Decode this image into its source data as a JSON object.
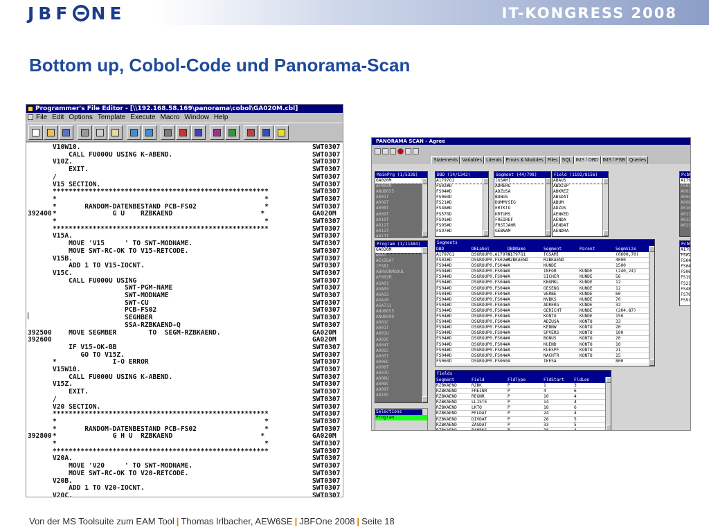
{
  "header": {
    "logo": "JBFONE",
    "logo_prefix": "JBF",
    "logo_suffix": "NE",
    "event": "IT-KONGRESS 2008"
  },
  "title": "Bottom up, Cobol-Code und Panorama-Scan",
  "footer": {
    "part1": "Von der MS Toolsuite zum EAM Tool",
    "part2": "Thomas Irlbacher, AEW6SE",
    "part3": "JBFOne 2008",
    "part4": "Seite 18",
    "separator": "|"
  },
  "editor": {
    "title": "Programmer's File Editor - [\\\\192.168.58.169\\panorama\\cobol\\GA020M.cbl]",
    "menu": [
      "File",
      "Edit",
      "Options",
      "Template",
      "Execute",
      "Macro",
      "Window",
      "Help"
    ],
    "toolbar_icons": [
      "new-file-icon",
      "open-folder-icon",
      "save-icon",
      "cut-icon",
      "copy-icon",
      "paste-icon",
      "find-icon",
      "find-next-icon",
      "print-icon",
      "execute-icon",
      "macro-icon",
      "options-icon",
      "settings-icon",
      "wrap-icon",
      "abc-case-icon",
      "help-icon"
    ],
    "lines": [
      {
        "seq": "",
        "code": "V10W10.",
        "id": "SWT0307"
      },
      {
        "seq": "",
        "code": "    CALL FU000U USING K-ABEND.",
        "id": "SWT0307"
      },
      {
        "seq": "",
        "code": "V10Z.",
        "id": "SWT0307"
      },
      {
        "seq": "",
        "code": "    EXIT.",
        "id": "SWT0307"
      },
      {
        "seq": "",
        "code": "/",
        "id": "SWT0307"
      },
      {
        "seq": "",
        "code": "V15 SECTION.",
        "id": "SWT0307"
      },
      {
        "seq": "",
        "code": "******************************************************",
        "id": "SWT0307"
      },
      {
        "seq": "",
        "code": "*                                                    *",
        "id": "SWT0307"
      },
      {
        "seq": "",
        "code": "*       RANDOM-DATENBESTAND PCB-FS02                 *",
        "id": "SWT0307"
      },
      {
        "seq": "392400",
        "code": "*              G U    RZBKAEND                      *",
        "id": "GA020M"
      },
      {
        "seq": "",
        "code": "*                                                    *",
        "id": "SWT0307"
      },
      {
        "seq": "",
        "code": "******************************************************",
        "id": "SWT0307"
      },
      {
        "seq": "",
        "code": "V15A.",
        "id": "SWT0307"
      },
      {
        "seq": "",
        "code": "    MOVE 'V15     ' TO SWT-MODNAME.",
        "id": "SWT0307"
      },
      {
        "seq": "",
        "code": "    MOVE SWT-RC-OK TO V15-RETCODE.",
        "id": "SWT0307"
      },
      {
        "seq": "",
        "code": "V15B.",
        "id": "SWT0307"
      },
      {
        "seq": "",
        "code": "    ADD 1 TO V15-IOCNT.",
        "id": "SWT0307"
      },
      {
        "seq": "",
        "code": "V15C.",
        "id": "SWT0307"
      },
      {
        "seq": "",
        "code": "    CALL FU000U USING",
        "id": "SWT0307"
      },
      {
        "seq": "",
        "code": "                  SWT-PGM-NAME",
        "id": "SWT0307"
      },
      {
        "seq": "",
        "code": "                  SWT-MODNAME",
        "id": "SWT0307"
      },
      {
        "seq": "",
        "code": "                  SWT-CU",
        "id": "SWT0307"
      },
      {
        "seq": "",
        "code": "                  PCB-FS02",
        "id": "SWT0307"
      },
      {
        "seq": "",
        "code": "                  SEGHBER",
        "id": "SWT0307"
      },
      {
        "seq": "",
        "code": "                  SSA-RZBKAEND-Q",
        "id": "SWT0307"
      },
      {
        "seq": "392500",
        "code": "    MOVE SEGMBER        TO  SEGM-RZBKAEND.",
        "id": "GA020M"
      },
      {
        "seq": "392600",
        "code": "",
        "id": "GA020M"
      },
      {
        "seq": "",
        "code": "    IF V15-OK-BB",
        "id": "SWT0307"
      },
      {
        "seq": "",
        "code": "       GO TO V15Z.",
        "id": "SWT0307"
      },
      {
        "seq": "",
        "code": "*              I-O ERROR",
        "id": "SWT0307"
      },
      {
        "seq": "",
        "code": "V15W10.",
        "id": "SWT0307"
      },
      {
        "seq": "",
        "code": "    CALL FU000U USING K-ABEND.",
        "id": "SWT0307"
      },
      {
        "seq": "",
        "code": "V15Z.",
        "id": "SWT0307"
      },
      {
        "seq": "",
        "code": "    EXIT.",
        "id": "SWT0307"
      },
      {
        "seq": "",
        "code": "/",
        "id": "SWT0307"
      },
      {
        "seq": "",
        "code": "V20 SECTION.",
        "id": "SWT0307"
      },
      {
        "seq": "",
        "code": "******************************************************",
        "id": "SWT0307"
      },
      {
        "seq": "",
        "code": "*                                                    *",
        "id": "SWT0307"
      },
      {
        "seq": "",
        "code": "*       RANDOM-DATENBESTAND PCB-FS02                 *",
        "id": "SWT0307"
      },
      {
        "seq": "392800",
        "code": "*              G H U  RZBKAEND                      *",
        "id": "GA020M"
      },
      {
        "seq": "",
        "code": "*                                                    *",
        "id": "SWT0307"
      },
      {
        "seq": "",
        "code": "******************************************************",
        "id": "SWT0307"
      },
      {
        "seq": "",
        "code": "V20A.",
        "id": "SWT0307"
      },
      {
        "seq": "",
        "code": "    MOVE 'V20     ' TO SWT-MODNAME.",
        "id": "SWT0307"
      },
      {
        "seq": "",
        "code": "    MOVE SWT-RC-OK TO V20-RETCODE.",
        "id": "SWT0307"
      },
      {
        "seq": "",
        "code": "V20B.",
        "id": "SWT0307"
      },
      {
        "seq": "",
        "code": "    ADD 1 TO V20-IOCNT.",
        "id": "SWT0307"
      },
      {
        "seq": "",
        "code": "V20C.",
        "id": "SWT0307"
      }
    ]
  },
  "panorama": {
    "title": "PANORAMA SCAN - Agree",
    "tabs": [
      "Statements",
      "Variables",
      "Literals",
      "Errors & Modules",
      "Files",
      "SQL",
      "IMS / DBD",
      "IMS / PSB",
      "Queries"
    ],
    "active_tab": "IMS / DBD",
    "mainprg": {
      "header": "MainPrg (1/5338)",
      "items": [
        "GA020M",
        "AF002M",
        "ANUB055",
        "A001T",
        "A006T",
        "A008T",
        "A009T",
        "A010T",
        "A011T",
        "A012T",
        "A013T"
      ]
    },
    "program": {
      "header": "Program (1/11484)",
      "items": [
        "GA020M",
        "#DAT",
        "#EXIDAT",
        "[PSB]",
        "ABRVORMODUL",
        "AF002M",
        "AGA01",
        "AGA05",
        "AGA15",
        "AGA20",
        "AGA731",
        "ANUB055",
        "ANUB099",
        "A001C",
        "A001T",
        "A001U",
        "A003C",
        "A004T",
        "A005C",
        "A005T",
        "A006C",
        "A006T",
        "A007U",
        "A008U",
        "A009C",
        "A009T",
        "A010C"
      ]
    },
    "selections": {
      "header": "Selections",
      "items": [
        "Program"
      ]
    },
    "dbd": {
      "header": "DBD (14/1342)",
      "items": [
        "A1797G1",
        "FS02#D",
        "FS04#D",
        "FS060D",
        "FS21#D",
        "FS48#D",
        "FS570D",
        "FS91#D",
        "FS95#D",
        "FS97#D"
      ]
    },
    "segment": {
      "header": "Segment (44/798)",
      "items": [
        "[GSAM]",
        "ADRERG",
        "ADZUSA",
        "BONUS",
        "DUMMYSEG",
        "ERTKTO",
        "KRTUMS",
        "FREIREF",
        "FRSTJAHR",
        "GEBNAM"
      ]
    },
    "field": {
      "header": "Field (1192/8156)",
      "items": [
        "ABAUS",
        "ABDISP",
        "ABKREZ",
        "ABSDAT",
        "ABUM",
        "ADZUS",
        "AENKED",
        "AENDA",
        "AENDAT",
        "AENDRA"
      ]
    },
    "pcb": {
      "header": "PcbNr",
      "items": [
        "A179",
        "FS02",
        "A001",
        "A003",
        "A008",
        "A010",
        "A011",
        "A012",
        "A013"
      ]
    },
    "pcb2": {
      "header": "PcbN",
      "items": [
        "A179",
        "FS02",
        "FS04",
        "FS04",
        "FS06",
        "FS19",
        "FS21",
        "FS48",
        "FS70",
        "FS91"
      ]
    },
    "segments_table": {
      "title": "Segments",
      "columns": [
        "DBD",
        "DBLabel",
        "DBDName",
        "Segment",
        "Parent",
        "SegmSize"
      ],
      "rows": [
        [
          "A1797G1",
          "DSGROUP0.A1797G1",
          "A1797G1",
          "[GSAM]",
          "",
          "(0600,70)"
        ],
        [
          "FS02#D",
          "DSGROUP0.FS02#A",
          "RZBKAEND",
          "RZBKAEND",
          "",
          "4000"
        ],
        [
          "FS04#D",
          "DSGROUP0.FS04#A",
          "",
          "KUNDE",
          "",
          "1500"
        ],
        [
          "FS04#D",
          "DSGROUP0.FS04#A",
          "",
          "INFOR",
          "KUNDE",
          "(240,24)"
        ],
        [
          "FS04#D",
          "DSGROUP0.FS04#A",
          "",
          "SICHER",
          "KUNDE",
          "56"
        ],
        [
          "FS04#D",
          "DSGROUP0.FS04#A",
          "",
          "KNGMKL",
          "KUNDE",
          "12"
        ],
        [
          "FS04#D",
          "DSGROUP0.FS04#A",
          "",
          "GESENG",
          "KUNDE",
          "12"
        ],
        [
          "FS04#D",
          "DSGROUP0.FS04#A",
          "",
          "VERBE",
          "KUNDE",
          "60"
        ],
        [
          "FS04#D",
          "DSGROUP0.FS04#A",
          "",
          "NVBKS",
          "KUNDE",
          "70"
        ],
        [
          "FS04#D",
          "DSGROUP0.FS04#A",
          "",
          "ADRERG",
          "KUNDE",
          "32"
        ],
        [
          "FS04#D",
          "DSGROUP0.FS04#A",
          "",
          "GERICHT",
          "KUNDE",
          "(204,87)"
        ],
        [
          "FS04#D",
          "DSGROUP0.FS04#A",
          "",
          "KONTO",
          "KUNDE",
          "150"
        ],
        [
          "FS04#D",
          "DSGROUP0.FS04#A",
          "",
          "ADZUSA",
          "KONTO",
          "33"
        ],
        [
          "FS04#D",
          "DSGROUP0.FS04#A",
          "",
          "KENNW",
          "KONTO",
          "20"
        ],
        [
          "FS04#D",
          "DSGROUP0.FS04#A",
          "",
          "SPVERS",
          "KONTO",
          "100"
        ],
        [
          "FS04#D",
          "DSGROUP0.FS04#A",
          "",
          "BONUS",
          "KONTO",
          "20"
        ],
        [
          "FS04#D",
          "DSGROUP0.FS04#A",
          "",
          "KUEND",
          "KONTO",
          "10"
        ],
        [
          "FS04#D",
          "DSGROUP0.FS04#A",
          "",
          "KUESPF",
          "KONTO",
          "21"
        ],
        [
          "FS04#D",
          "DSGROUP0.FS04#A",
          "",
          "NACHTR",
          "KONTO",
          "15"
        ],
        [
          "FS060D",
          "DSGROUP0.FS060A",
          "",
          "IKESA",
          "",
          "800"
        ]
      ]
    },
    "fields_table": {
      "title": "Fields",
      "columns": [
        "Segment",
        "Field",
        "FldType",
        "FldStart",
        "FldLen"
      ],
      "rows": [
        [
          "RZBKAEND",
          "RZBK",
          "P",
          "1",
          "3"
        ],
        [
          "RZBKAEND",
          "FREINR",
          "P",
          "4",
          "6"
        ],
        [
          "RZBKAEND",
          "REGNR",
          "P",
          "10",
          "4"
        ],
        [
          "RZBKAEND",
          "LLISTE",
          "P",
          "14",
          "4"
        ],
        [
          "RZBKAEND",
          "LKTO",
          "P",
          "18",
          "6"
        ],
        [
          "RZBKAEND",
          "PFLDAT",
          "P",
          "24",
          "4"
        ],
        [
          "RZBKAEND",
          "DIVDAT",
          "P",
          "28",
          "5"
        ],
        [
          "RZBKAEND",
          "ZASDAT",
          "P",
          "33",
          "5"
        ],
        [
          "RZBKAEND",
          "BANBKS",
          "P",
          "38",
          "4"
        ]
      ]
    }
  }
}
